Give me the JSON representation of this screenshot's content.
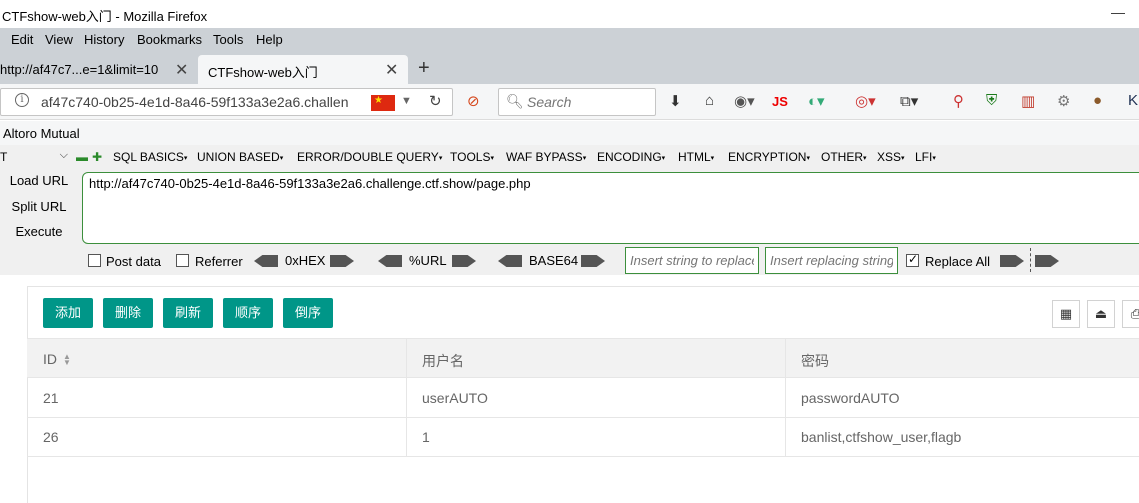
{
  "window": {
    "title": "CTFshow-web入门 - Mozilla Firefox"
  },
  "menu": [
    "Edit",
    "View",
    "History",
    "Bookmarks",
    "Tools",
    "Help"
  ],
  "tabs": [
    {
      "label": "http://af47c7...e=1&limit=10"
    },
    {
      "label": "CTFshow-web入门"
    }
  ],
  "nav": {
    "url": "af47c740-0b25-4e1d-8a46-59f133a3e2a6.challen",
    "search_placeholder": "Search"
  },
  "bookmarks": [
    "Altoro Mutual"
  ],
  "hackbar": {
    "select_value": "T",
    "menus": [
      "SQL BASICS",
      "UNION BASED",
      "ERROR/DOUBLE QUERY",
      "TOOLS",
      "WAF BYPASS",
      "ENCODING",
      "HTML",
      "ENCRYPTION",
      "OTHER",
      "XSS",
      "LFI"
    ],
    "load_url": "Load URL",
    "split_url": "Split URL",
    "execute": "Execute",
    "url_value": "http://af47c740-0b25-4e1d-8a46-59f133a3e2a6.challenge.ctf.show/page.php",
    "post_data": "Post data",
    "referrer": "Referrer",
    "hex": "0xHEX",
    "url_enc": "%URL",
    "base64": "BASE64",
    "replace_placeholder": "Insert string to replace",
    "replacing_placeholder": "Insert replacing string",
    "replace_all": "Replace All"
  },
  "toolbar": [
    "添加",
    "删除",
    "刷新",
    "顺序",
    "倒序"
  ],
  "table": {
    "columns": [
      "ID",
      "用户名",
      "密码"
    ],
    "rows": [
      [
        "21",
        "userAUTO",
        "passwordAUTO"
      ],
      [
        "26",
        "1",
        "banlist,ctfshow_user,flagb"
      ]
    ]
  }
}
